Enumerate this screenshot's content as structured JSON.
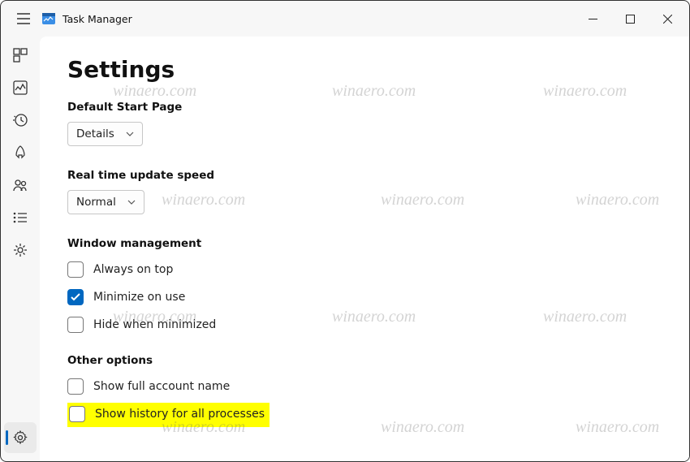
{
  "window": {
    "title": "Task Manager"
  },
  "page": {
    "heading": "Settings"
  },
  "startPage": {
    "label": "Default Start Page",
    "value": "Details"
  },
  "updateSpeed": {
    "label": "Real time update speed",
    "value": "Normal"
  },
  "windowMgmt": {
    "label": "Window management",
    "alwaysOnTop": {
      "label": "Always on top",
      "checked": false
    },
    "minimizeOnUse": {
      "label": "Minimize on use",
      "checked": true
    },
    "hideWhenMinimized": {
      "label": "Hide when minimized",
      "checked": false
    }
  },
  "otherOptions": {
    "label": "Other options",
    "showFullAccountName": {
      "label": "Show full account name",
      "checked": false
    },
    "showHistoryAll": {
      "label": "Show history for all processes",
      "checked": false
    }
  },
  "watermark": "winaero.com",
  "colors": {
    "accent": "#0067c0",
    "highlight": "#ffff00"
  }
}
